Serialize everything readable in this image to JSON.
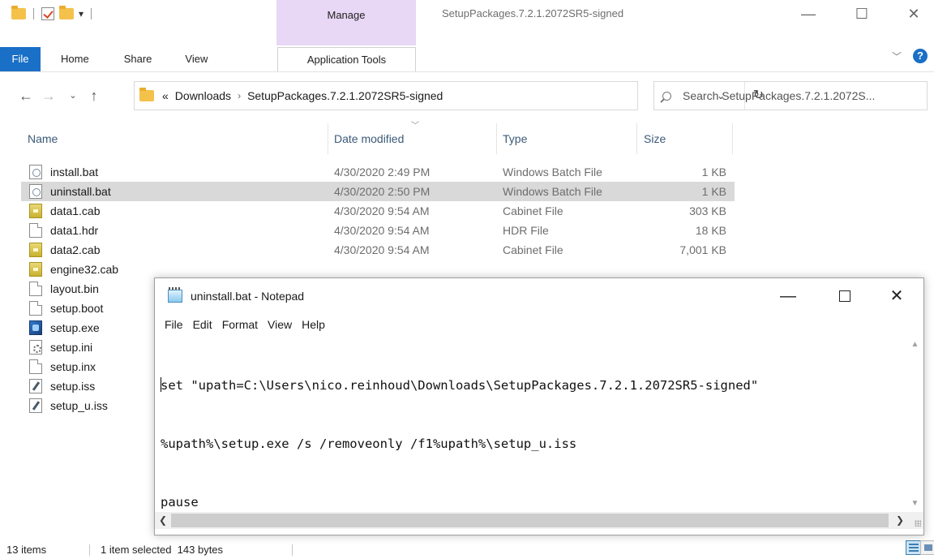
{
  "explorer": {
    "title": "SetupPackages.7.2.1.2072SR5-signed",
    "context_tab": "Manage",
    "ribbon_tabs": [
      "File",
      "Home",
      "Share",
      "View",
      "Application Tools"
    ],
    "breadcrumb": {
      "overflow": "«",
      "items": [
        "Downloads",
        "SetupPackages.7.2.1.2072SR5-signed"
      ],
      "separator": "›"
    },
    "search_placeholder": "Search SetupPackages.7.2.1.2072S...",
    "columns": {
      "name": "Name",
      "date": "Date modified",
      "type": "Type",
      "size": "Size"
    },
    "files": [
      {
        "name": "install.bat",
        "date": "4/30/2020 2:49 PM",
        "type": "Windows Batch File",
        "size": "1 KB",
        "icon": "batch-file-icon"
      },
      {
        "name": "uninstall.bat",
        "date": "4/30/2020 2:50 PM",
        "type": "Windows Batch File",
        "size": "1 KB",
        "icon": "batch-file-icon",
        "selected": true
      },
      {
        "name": "data1.cab",
        "date": "4/30/2020 9:54 AM",
        "type": "Cabinet File",
        "size": "303 KB",
        "icon": "cabinet-file-icon"
      },
      {
        "name": "data1.hdr",
        "date": "4/30/2020 9:54 AM",
        "type": "HDR File",
        "size": "18 KB",
        "icon": "file-icon"
      },
      {
        "name": "data2.cab",
        "date": "4/30/2020 9:54 AM",
        "type": "Cabinet File",
        "size": "7,001 KB",
        "icon": "cabinet-file-icon"
      },
      {
        "name": "engine32.cab",
        "date": "",
        "type": "",
        "size": "",
        "icon": "cabinet-file-icon"
      },
      {
        "name": "layout.bin",
        "date": "",
        "type": "",
        "size": "",
        "icon": "file-icon"
      },
      {
        "name": "setup.boot",
        "date": "",
        "type": "",
        "size": "",
        "icon": "file-icon"
      },
      {
        "name": "setup.exe",
        "date": "",
        "type": "",
        "size": "",
        "icon": "setup-exe-icon"
      },
      {
        "name": "setup.ini",
        "date": "",
        "type": "",
        "size": "",
        "icon": "settings-file-icon"
      },
      {
        "name": "setup.inx",
        "date": "",
        "type": "",
        "size": "",
        "icon": "file-icon"
      },
      {
        "name": "setup.iss",
        "date": "",
        "type": "",
        "size": "",
        "icon": "iss-file-icon"
      },
      {
        "name": "setup_u.iss",
        "date": "",
        "type": "",
        "size": "",
        "icon": "iss-file-icon"
      }
    ],
    "status": {
      "items": "13 items",
      "selection": "1 item selected  143 bytes"
    },
    "accent_color": "#1a6fc6",
    "manage_tab_color": "#e8d7f5",
    "selection_color": "#d9d9d9"
  },
  "notepad": {
    "title": "uninstall.bat - Notepad",
    "menu": [
      "File",
      "Edit",
      "Format",
      "View",
      "Help"
    ],
    "lines": [
      "set \"upath=C:\\Users\\nico.reinhoud\\Downloads\\SetupPackages.7.2.1.2072SR5-signed\"",
      "%upath%\\setup.exe /s /removeonly /f1%upath%\\setup_u.iss",
      "pause"
    ]
  }
}
